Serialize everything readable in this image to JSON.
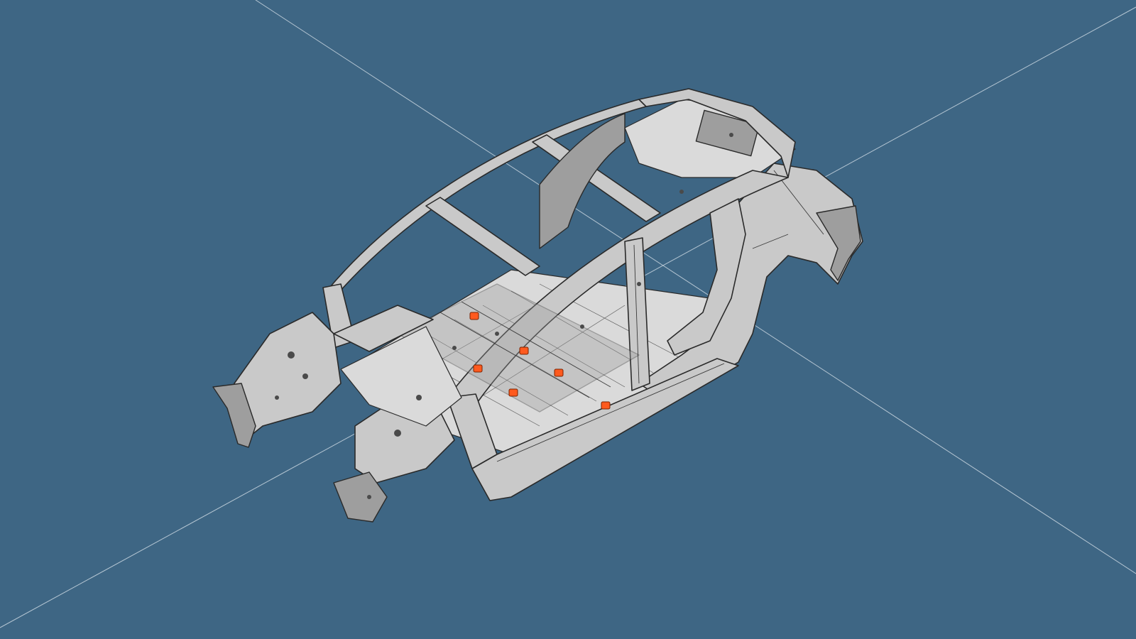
{
  "scene": {
    "background_color": "#3e6684",
    "axis_line_color": "#c9d6e0",
    "model_color": "#c9c9c9",
    "marker_color": "#ff5a1e",
    "marker_count": 6
  }
}
